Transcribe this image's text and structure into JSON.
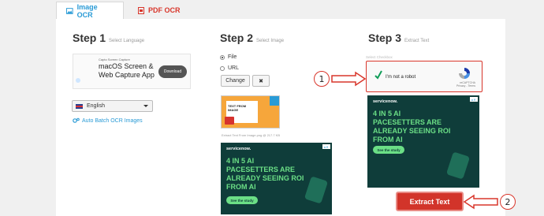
{
  "tabs": [
    {
      "label": "Image OCR",
      "active": true
    },
    {
      "label": "PDF OCR",
      "active": false
    }
  ],
  "step1": {
    "title": "Step 1",
    "subtitle": "Select Language"
  },
  "step2": {
    "title": "Step 2",
    "subtitle": "Select Image"
  },
  "step3": {
    "title": "Step 3",
    "subtitle": "Extract Text"
  },
  "ad_capto": {
    "small": "Capto Screen Capture",
    "headline": "macOS Screen & Web Capture App",
    "button": "Download"
  },
  "language": {
    "selected": "English"
  },
  "batch_link": "Auto Batch OCR Images",
  "source": {
    "options": [
      "File",
      "URL"
    ],
    "selected": "File",
    "change_label": "Change",
    "remove_label": "✖"
  },
  "preview": {
    "text": "TEXT FROM IMAGE",
    "meta": "Extract Text From Image.png @ 217.7 KB"
  },
  "ad_servicenow": {
    "brand": "servicenow.",
    "headline": "4 IN 5 AI PACESETTERS ARE ALREADY SEEING ROI FROM AI",
    "cta": "See the study"
  },
  "captcha": {
    "label": "Select Checkbox",
    "text": "I'm not a robot",
    "brand": "reCAPTCHA",
    "links": "Privacy - Terms"
  },
  "extract_button": "Extract Text",
  "callouts": [
    "1",
    "2"
  ],
  "colors": {
    "accent_blue": "#2a9bd6",
    "accent_red": "#d9362b",
    "ad_green": "#0f3d3a"
  }
}
